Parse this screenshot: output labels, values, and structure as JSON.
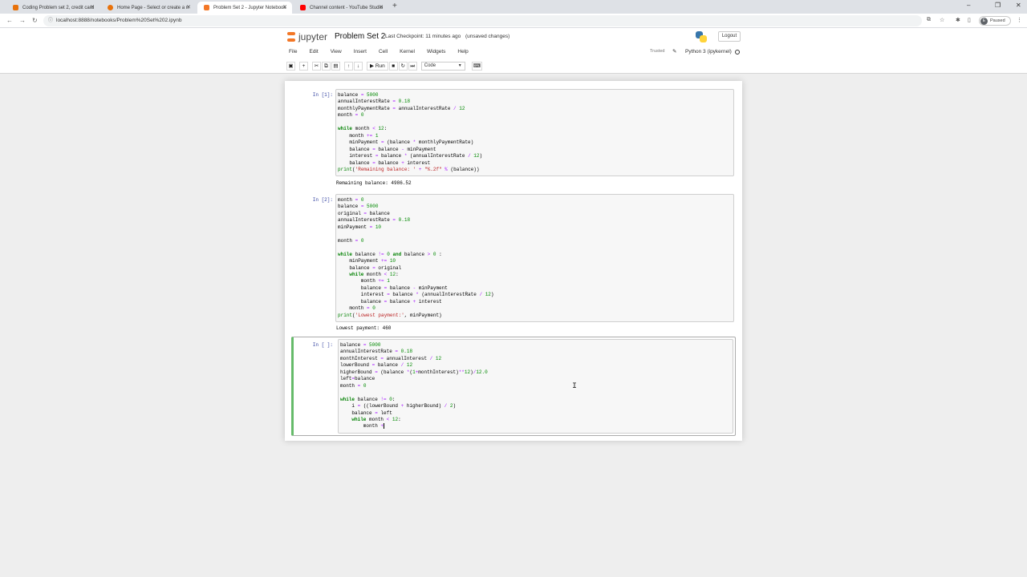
{
  "browser": {
    "tabs": [
      {
        "title": "Coding Problem set 2, credit card",
        "color": "#e8710a"
      },
      {
        "title": "Home Page - Select or create a n",
        "color": "#e8710a"
      },
      {
        "title": "Problem Set 2 - Jupyter Notebook",
        "color": "#f37726"
      },
      {
        "title": "Channel content - YouTube Studio",
        "color": "#ff0000"
      }
    ],
    "new_tab": "+",
    "url": "localhost:8888/notebooks/Problem%20Set%202.ipynb",
    "profile_initial": "E",
    "profile_label": "Paused"
  },
  "jupyter": {
    "logo_text": "jupyter",
    "title": "Problem Set 2",
    "checkpoint": "Last Checkpoint: 11 minutes ago",
    "unsaved": "(unsaved changes)",
    "logout": "Logout",
    "menu": [
      "File",
      "Edit",
      "View",
      "Insert",
      "Cell",
      "Kernel",
      "Widgets",
      "Help"
    ],
    "trusted": "Trusted",
    "kernel_name": "Python 3 (ipykernel)",
    "run_label": "Run",
    "cell_type": "Code"
  },
  "cells": [
    {
      "prompt": "In [1]:",
      "output": "Remaining balance: 4986.52"
    },
    {
      "prompt": "In [2]:",
      "output": "Lowest payment: 460"
    },
    {
      "prompt": "In [ ]:",
      "output": ""
    }
  ]
}
